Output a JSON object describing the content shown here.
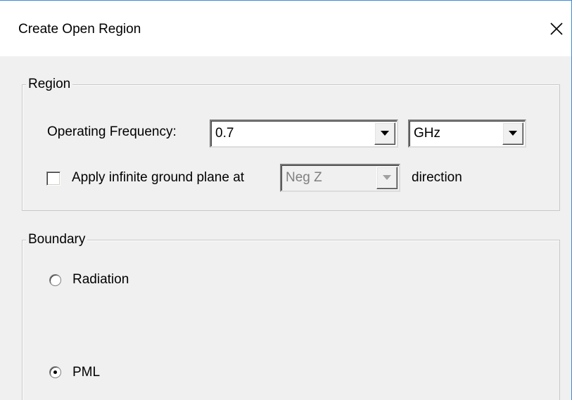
{
  "window": {
    "title": "Create Open Region",
    "close_icon": "close-icon"
  },
  "region": {
    "legend": "Region",
    "frequency_label": "Operating Frequency:",
    "frequency_value": "0.7",
    "unit_value": "GHz",
    "ground_plane_label": "Apply infinite ground plane at",
    "ground_plane_checked": false,
    "ground_direction_value": "Neg Z",
    "ground_direction_enabled": false,
    "direction_suffix": "direction"
  },
  "boundary": {
    "legend": "Boundary",
    "options": [
      {
        "label": "Radiation",
        "selected": false
      },
      {
        "label": "PML",
        "selected": true
      }
    ]
  }
}
